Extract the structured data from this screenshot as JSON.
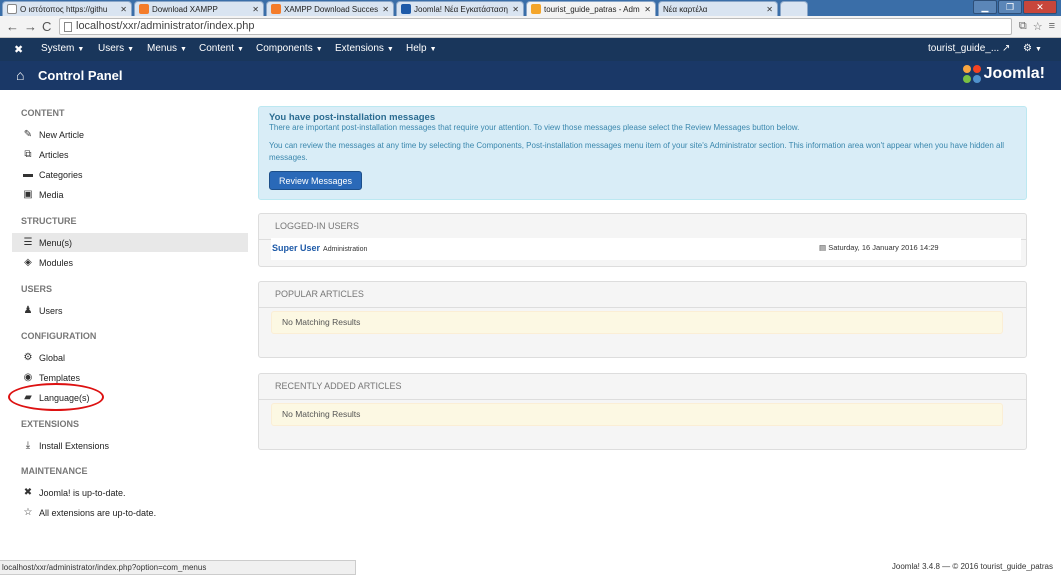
{
  "browser": {
    "tabs": [
      {
        "label": "Ο ιστότοπος https://githu",
        "close": "✕",
        "color": "#ffffff"
      },
      {
        "label": "Download XAMPP",
        "close": "✕",
        "color": "#f47c2a"
      },
      {
        "label": "XAMPP Download Succes",
        "close": "✕",
        "color": "#f47c2a"
      },
      {
        "label": "Joomla! Νέα Εγκατάσταση",
        "close": "✕",
        "color": "#1e5aa8"
      },
      {
        "label": "tourist_guide_patras - Adm",
        "close": "✕",
        "color": "#f4a52a"
      },
      {
        "label": "Νέα καρτέλα",
        "close": "✕",
        "color": ""
      }
    ],
    "url": "localhost/xxr/administrator/index.php",
    "win_controls": [
      "▁",
      "❐",
      "✕"
    ]
  },
  "topnav": {
    "menus": [
      "System",
      "Users",
      "Menus",
      "Content",
      "Components",
      "Extensions",
      "Help"
    ],
    "site_link": "tourist_guide_...",
    "site_link_icon": "external-link-icon",
    "settings_icon": "gear-icon"
  },
  "header": {
    "title": "Control Panel",
    "logo_text": "Joomla!"
  },
  "sidebar": {
    "sections": [
      {
        "title": "CONTENT",
        "items": [
          {
            "label": "New Article",
            "icon": "pencil-icon"
          },
          {
            "label": "Articles",
            "icon": "stack-icon"
          },
          {
            "label": "Categories",
            "icon": "folder-icon"
          },
          {
            "label": "Media",
            "icon": "image-icon"
          }
        ]
      },
      {
        "title": "STRUCTURE",
        "items": [
          {
            "label": "Menu(s)",
            "icon": "list-icon"
          },
          {
            "label": "Modules",
            "icon": "cube-icon"
          }
        ]
      },
      {
        "title": "USERS",
        "items": [
          {
            "label": "Users",
            "icon": "users-icon"
          }
        ]
      },
      {
        "title": "CONFIGURATION",
        "items": [
          {
            "label": "Global",
            "icon": "cog-icon"
          },
          {
            "label": "Templates",
            "icon": "eye-icon"
          },
          {
            "label": "Language(s)",
            "icon": "comments-icon"
          }
        ]
      },
      {
        "title": "EXTENSIONS",
        "items": [
          {
            "label": "Install Extensions",
            "icon": "upload-icon"
          }
        ]
      },
      {
        "title": "MAINTENANCE",
        "items": [
          {
            "label": "Joomla! is up-to-date.",
            "icon": "joomla-icon"
          },
          {
            "label": "All extensions are up-to-date.",
            "icon": "star-icon"
          }
        ]
      }
    ]
  },
  "messages": {
    "heading": "You have post-installation messages",
    "line1": "There are important post-installation messages that require your attention. To view those messages please select the Review Messages button below.",
    "line2": "You can review the messages at any time by selecting the Components, Post-installation messages menu item of your site's Administrator section. This information area won't appear when you have hidden all messages.",
    "button": "Review Messages"
  },
  "logged_in": {
    "title": "LOGGED-IN USERS",
    "user": "Super User",
    "location": "Administration",
    "date": "Saturday, 16 January 2016 14:29"
  },
  "popular": {
    "title": "POPULAR ARTICLES",
    "empty": "No Matching Results"
  },
  "recent": {
    "title": "RECENTLY ADDED ARTICLES",
    "empty": "No Matching Results"
  },
  "status": {
    "url": "localhost/xxr/administrator/index.php?option=com_menus",
    "footer": "Joomla! 3.4.8 — © 2016 tourist_guide_patras"
  }
}
